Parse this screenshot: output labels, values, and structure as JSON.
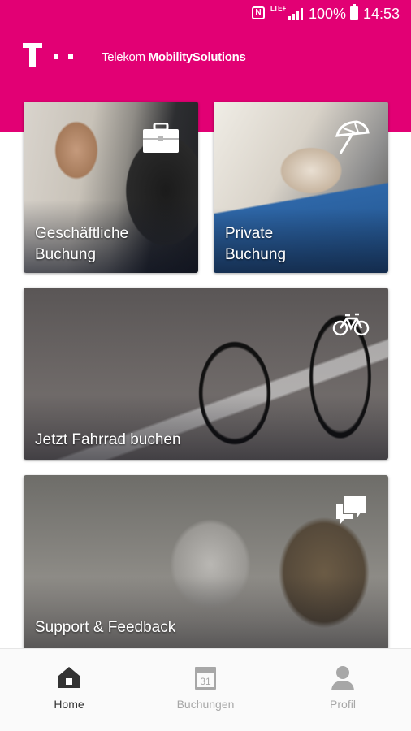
{
  "status_bar": {
    "nfc": "N",
    "network": "LTE+",
    "battery_percent": "100%",
    "time": "14:53"
  },
  "header": {
    "brand_light": "Telekom ",
    "brand_bold": "MobilitySolutions"
  },
  "tiles": [
    {
      "label_line1": "Geschäftliche",
      "label_line2": "Buchung",
      "icon": "briefcase-icon"
    },
    {
      "label_line1": "Private",
      "label_line2": "Buchung",
      "icon": "umbrella-icon"
    },
    {
      "label": "Jetzt Fahrrad buchen",
      "icon": "bicycle-icon"
    },
    {
      "label": "Support & Feedback",
      "icon": "chat-bubbles-icon"
    }
  ],
  "bottom_nav": {
    "items": [
      {
        "label": "Home",
        "icon": "home-icon",
        "active": true
      },
      {
        "label": "Buchungen",
        "icon": "calendar-icon",
        "calendar_day": "31",
        "active": false
      },
      {
        "label": "Profil",
        "icon": "person-icon",
        "active": false
      }
    ]
  },
  "colors": {
    "brand_magenta": "#e20074",
    "nav_active": "#333333",
    "nav_inactive": "#a7a7a7"
  }
}
